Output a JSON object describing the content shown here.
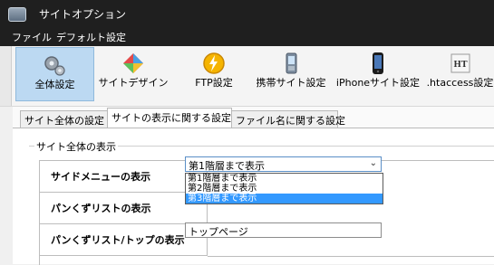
{
  "window": {
    "title": "サイトオプション"
  },
  "menu": {
    "items": [
      "ファイル",
      "デフォルト設定"
    ]
  },
  "toolbar": {
    "buttons": [
      {
        "label": "全体設定",
        "icon": "gears-icon",
        "active": true
      },
      {
        "label": "サイトデザイン",
        "icon": "palette-icon",
        "active": false
      },
      {
        "label": "FTP設定",
        "icon": "lightning-icon",
        "active": false
      },
      {
        "label": "携帯サイト設定",
        "icon": "mobile-phone-icon",
        "active": false
      },
      {
        "label": "iPhoneサイト設定",
        "icon": "iphone-icon",
        "active": false
      },
      {
        "label": ".htaccess設定",
        "icon": "ht-file-icon",
        "active": false
      }
    ]
  },
  "tabs": [
    {
      "label": "サイト全体の設定",
      "active": false
    },
    {
      "label": "サイトの表示に関する設定",
      "active": true
    },
    {
      "label": "ファイル名に関する設定",
      "active": false
    }
  ],
  "group": {
    "label": "サイト全体の表示"
  },
  "rows": [
    {
      "label": "サイドメニューの表示"
    },
    {
      "label": "パンくずリストの表示"
    },
    {
      "label": "パンくずリスト/トップの表示"
    }
  ],
  "side_menu_select": {
    "value": "第1階層まで表示",
    "options": [
      "第1階層まで表示",
      "第2階層まで表示",
      "第3階層まで表示"
    ],
    "highlighted_index": 2
  },
  "breadcrumb_top_input": {
    "value": "トップページ"
  },
  "colors": {
    "titlebar": "#1f1f1f",
    "active_toolbar": "#bcd9f2",
    "dropdown_highlight": "#3399ff"
  }
}
